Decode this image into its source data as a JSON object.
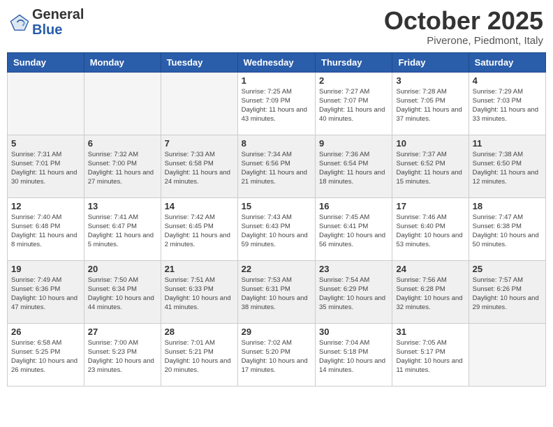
{
  "header": {
    "logo_general": "General",
    "logo_blue": "Blue",
    "month_title": "October 2025",
    "location": "Piverone, Piedmont, Italy"
  },
  "weekdays": [
    "Sunday",
    "Monday",
    "Tuesday",
    "Wednesday",
    "Thursday",
    "Friday",
    "Saturday"
  ],
  "weeks": [
    {
      "shaded": false,
      "days": [
        {
          "num": "",
          "info": ""
        },
        {
          "num": "",
          "info": ""
        },
        {
          "num": "",
          "info": ""
        },
        {
          "num": "1",
          "info": "Sunrise: 7:25 AM\nSunset: 7:09 PM\nDaylight: 11 hours\nand 43 minutes."
        },
        {
          "num": "2",
          "info": "Sunrise: 7:27 AM\nSunset: 7:07 PM\nDaylight: 11 hours\nand 40 minutes."
        },
        {
          "num": "3",
          "info": "Sunrise: 7:28 AM\nSunset: 7:05 PM\nDaylight: 11 hours\nand 37 minutes."
        },
        {
          "num": "4",
          "info": "Sunrise: 7:29 AM\nSunset: 7:03 PM\nDaylight: 11 hours\nand 33 minutes."
        }
      ]
    },
    {
      "shaded": true,
      "days": [
        {
          "num": "5",
          "info": "Sunrise: 7:31 AM\nSunset: 7:01 PM\nDaylight: 11 hours\nand 30 minutes."
        },
        {
          "num": "6",
          "info": "Sunrise: 7:32 AM\nSunset: 7:00 PM\nDaylight: 11 hours\nand 27 minutes."
        },
        {
          "num": "7",
          "info": "Sunrise: 7:33 AM\nSunset: 6:58 PM\nDaylight: 11 hours\nand 24 minutes."
        },
        {
          "num": "8",
          "info": "Sunrise: 7:34 AM\nSunset: 6:56 PM\nDaylight: 11 hours\nand 21 minutes."
        },
        {
          "num": "9",
          "info": "Sunrise: 7:36 AM\nSunset: 6:54 PM\nDaylight: 11 hours\nand 18 minutes."
        },
        {
          "num": "10",
          "info": "Sunrise: 7:37 AM\nSunset: 6:52 PM\nDaylight: 11 hours\nand 15 minutes."
        },
        {
          "num": "11",
          "info": "Sunrise: 7:38 AM\nSunset: 6:50 PM\nDaylight: 11 hours\nand 12 minutes."
        }
      ]
    },
    {
      "shaded": false,
      "days": [
        {
          "num": "12",
          "info": "Sunrise: 7:40 AM\nSunset: 6:48 PM\nDaylight: 11 hours\nand 8 minutes."
        },
        {
          "num": "13",
          "info": "Sunrise: 7:41 AM\nSunset: 6:47 PM\nDaylight: 11 hours\nand 5 minutes."
        },
        {
          "num": "14",
          "info": "Sunrise: 7:42 AM\nSunset: 6:45 PM\nDaylight: 11 hours\nand 2 minutes."
        },
        {
          "num": "15",
          "info": "Sunrise: 7:43 AM\nSunset: 6:43 PM\nDaylight: 10 hours\nand 59 minutes."
        },
        {
          "num": "16",
          "info": "Sunrise: 7:45 AM\nSunset: 6:41 PM\nDaylight: 10 hours\nand 56 minutes."
        },
        {
          "num": "17",
          "info": "Sunrise: 7:46 AM\nSunset: 6:40 PM\nDaylight: 10 hours\nand 53 minutes."
        },
        {
          "num": "18",
          "info": "Sunrise: 7:47 AM\nSunset: 6:38 PM\nDaylight: 10 hours\nand 50 minutes."
        }
      ]
    },
    {
      "shaded": true,
      "days": [
        {
          "num": "19",
          "info": "Sunrise: 7:49 AM\nSunset: 6:36 PM\nDaylight: 10 hours\nand 47 minutes."
        },
        {
          "num": "20",
          "info": "Sunrise: 7:50 AM\nSunset: 6:34 PM\nDaylight: 10 hours\nand 44 minutes."
        },
        {
          "num": "21",
          "info": "Sunrise: 7:51 AM\nSunset: 6:33 PM\nDaylight: 10 hours\nand 41 minutes."
        },
        {
          "num": "22",
          "info": "Sunrise: 7:53 AM\nSunset: 6:31 PM\nDaylight: 10 hours\nand 38 minutes."
        },
        {
          "num": "23",
          "info": "Sunrise: 7:54 AM\nSunset: 6:29 PM\nDaylight: 10 hours\nand 35 minutes."
        },
        {
          "num": "24",
          "info": "Sunrise: 7:56 AM\nSunset: 6:28 PM\nDaylight: 10 hours\nand 32 minutes."
        },
        {
          "num": "25",
          "info": "Sunrise: 7:57 AM\nSunset: 6:26 PM\nDaylight: 10 hours\nand 29 minutes."
        }
      ]
    },
    {
      "shaded": false,
      "days": [
        {
          "num": "26",
          "info": "Sunrise: 6:58 AM\nSunset: 5:25 PM\nDaylight: 10 hours\nand 26 minutes."
        },
        {
          "num": "27",
          "info": "Sunrise: 7:00 AM\nSunset: 5:23 PM\nDaylight: 10 hours\nand 23 minutes."
        },
        {
          "num": "28",
          "info": "Sunrise: 7:01 AM\nSunset: 5:21 PM\nDaylight: 10 hours\nand 20 minutes."
        },
        {
          "num": "29",
          "info": "Sunrise: 7:02 AM\nSunset: 5:20 PM\nDaylight: 10 hours\nand 17 minutes."
        },
        {
          "num": "30",
          "info": "Sunrise: 7:04 AM\nSunset: 5:18 PM\nDaylight: 10 hours\nand 14 minutes."
        },
        {
          "num": "31",
          "info": "Sunrise: 7:05 AM\nSunset: 5:17 PM\nDaylight: 10 hours\nand 11 minutes."
        },
        {
          "num": "",
          "info": ""
        }
      ]
    }
  ]
}
